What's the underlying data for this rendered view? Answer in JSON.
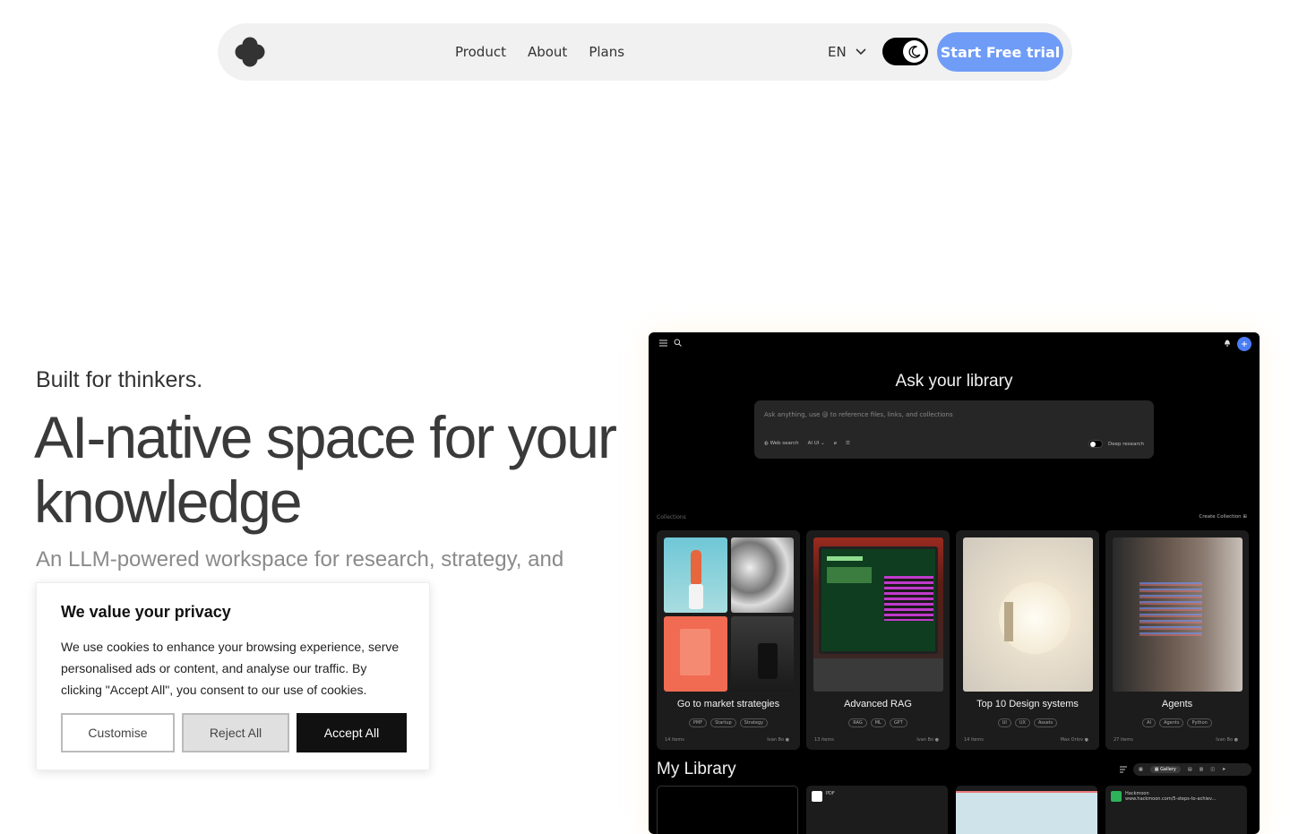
{
  "nav": {
    "links": [
      "Product",
      "About",
      "Plans"
    ],
    "language": "EN",
    "cta": "Start Free trial"
  },
  "hero": {
    "kicker": "Built for thinkers.",
    "title": "AI-native space for your knowledge",
    "subtitle": "An LLM-powered workspace for research, strategy, and"
  },
  "cookie": {
    "title": "We value your privacy",
    "body": "We use cookies to enhance your browsing experience, serve personalised ads or content, and analyse our traffic. By clicking \"Accept All\", you consent to our use of cookies.",
    "customise": "Customise",
    "reject": "Reject All",
    "accept": "Accept All"
  },
  "app": {
    "ask_title": "Ask your library",
    "ask_placeholder": "Ask anything, use @ to reference files, links, and collections",
    "tools": [
      "Web search",
      "AI UI"
    ],
    "deep_research": "Deep research",
    "collections_label": "Collections",
    "create_collection": "Create Collection",
    "cards": [
      {
        "title": "Go to market strategies",
        "tags": [
          "PMF",
          "Startup",
          "Strategy"
        ],
        "count": "14 items",
        "owner": "Ivan Bo"
      },
      {
        "title": "Advanced RAG",
        "tags": [
          "RAG",
          "ML",
          "GPT"
        ],
        "count": "13 items",
        "owner": "Ivan Bo"
      },
      {
        "title": "Top 10 Design systems",
        "tags": [
          "UI",
          "UX",
          "Assets"
        ],
        "count": "14 items",
        "owner": "Max Orlov"
      },
      {
        "title": "Agents",
        "tags": [
          "AI",
          "Agents",
          "Python"
        ],
        "count": "27 items",
        "owner": "Ivan Bo"
      }
    ],
    "my_library": "My Library",
    "gallery_label": "Gallery",
    "lib_items": [
      "",
      "PDF",
      "",
      "Hackmoon"
    ],
    "lib_sub": "www.hackmoon.com/5-steps-to-achiev..."
  },
  "colors": {
    "accent": "#6f9cf7",
    "app_bg": "#000000",
    "card_bg": "#1c1c1c"
  }
}
